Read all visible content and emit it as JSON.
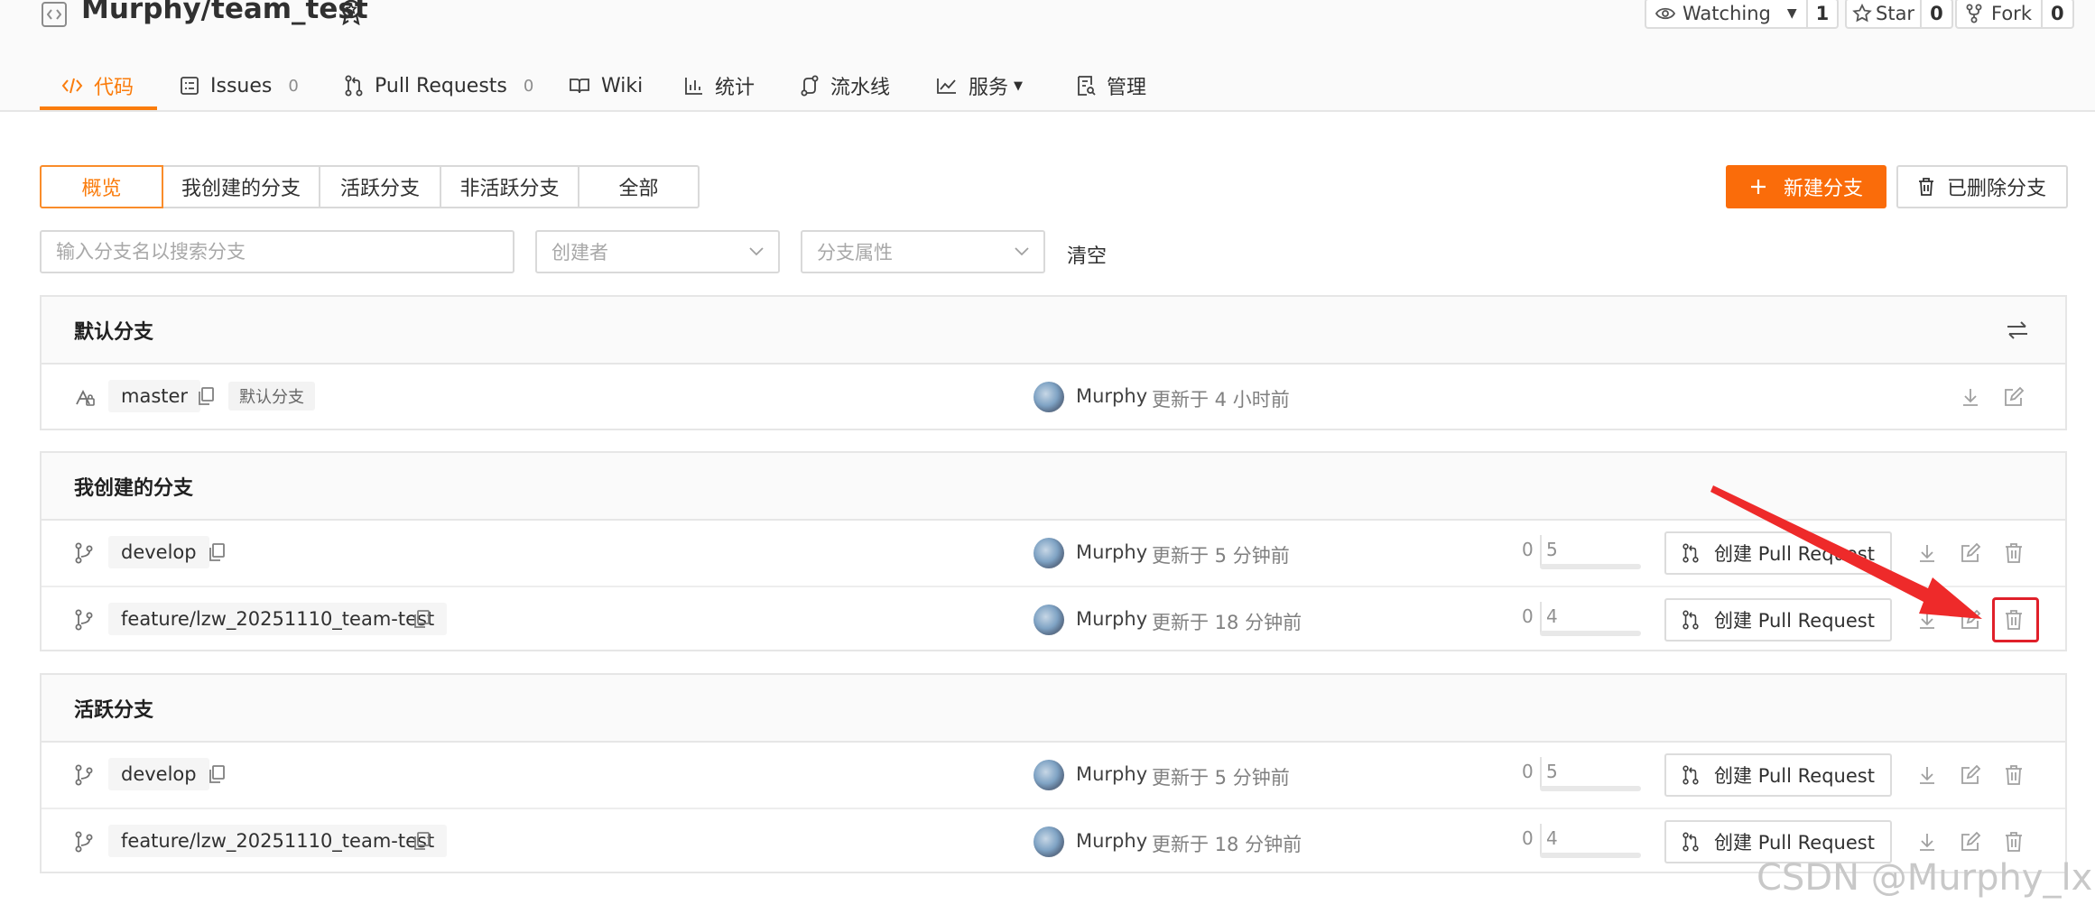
{
  "repo": {
    "title": "Murphy/team_test"
  },
  "social": {
    "watch": {
      "label": "Watching",
      "count": "1"
    },
    "star": {
      "label": "Star",
      "count": "0"
    },
    "fork": {
      "label": "Fork",
      "count": "0"
    }
  },
  "nav": {
    "tabs": [
      {
        "label": "代码",
        "count": ""
      },
      {
        "label": "Issues",
        "count": "0"
      },
      {
        "label": "Pull Requests",
        "count": "0"
      },
      {
        "label": "Wiki",
        "count": ""
      },
      {
        "label": "统计",
        "count": ""
      },
      {
        "label": "流水线",
        "count": ""
      },
      {
        "label": "服务",
        "count": ""
      },
      {
        "label": "管理",
        "count": ""
      }
    ],
    "active": "代码"
  },
  "filters": {
    "tabs": [
      "概览",
      "我创建的分支",
      "活跃分支",
      "非活跃分支",
      "全部"
    ],
    "active": "概览",
    "search_placeholder": "输入分支名以搜索分支",
    "creator_placeholder": "创建者",
    "attribute_placeholder": "分支属性",
    "clear_label": "清空"
  },
  "actions": {
    "new_branch": "新建分支",
    "deleted_branches": "已删除分支"
  },
  "sections": {
    "default": {
      "title": "默认分支",
      "rows": [
        {
          "name": "master",
          "tag": "默认分支",
          "author": "Murphy",
          "updated": "更新于 4 小时前"
        }
      ]
    },
    "mine": {
      "title": "我创建的分支",
      "rows": [
        {
          "name": "develop",
          "author": "Murphy",
          "updated": "更新于 5 分钟前",
          "ahead": "0",
          "behind": "5",
          "pr_label": "创建 Pull Request"
        },
        {
          "name": "feature/lzw_20251110_team-test",
          "author": "Murphy",
          "updated": "更新于 18 分钟前",
          "ahead": "0",
          "behind": "4",
          "pr_label": "创建 Pull Request"
        }
      ]
    },
    "active": {
      "title": "活跃分支",
      "rows": [
        {
          "name": "develop",
          "author": "Murphy",
          "updated": "更新于 5 分钟前",
          "ahead": "0",
          "behind": "5",
          "pr_label": "创建 Pull Request"
        },
        {
          "name": "feature/lzw_20251110_team-test",
          "author": "Murphy",
          "updated": "更新于 18 分钟前",
          "ahead": "0",
          "behind": "4",
          "pr_label": "创建 Pull Request"
        }
      ]
    }
  },
  "watermark": "CSDN @Murphy_lx",
  "colors": {
    "accent": "#fa7c0c",
    "primary_button": "#fa6c0a",
    "annotation": "#e0202a"
  },
  "icons": [
    "repo-icon",
    "badge-icon",
    "eye-icon",
    "star-icon",
    "fork-icon",
    "code-icon",
    "issues-icon",
    "pull-request-icon",
    "wiki-icon",
    "stats-icon",
    "pipeline-icon",
    "service-icon",
    "settings-icon",
    "plus-icon",
    "trash-icon",
    "chevron-down-icon",
    "swap-icon",
    "lock-branch-icon",
    "branch-icon",
    "copy-icon",
    "download-icon",
    "edit-icon",
    "delete-icon",
    "annotation-arrow"
  ]
}
